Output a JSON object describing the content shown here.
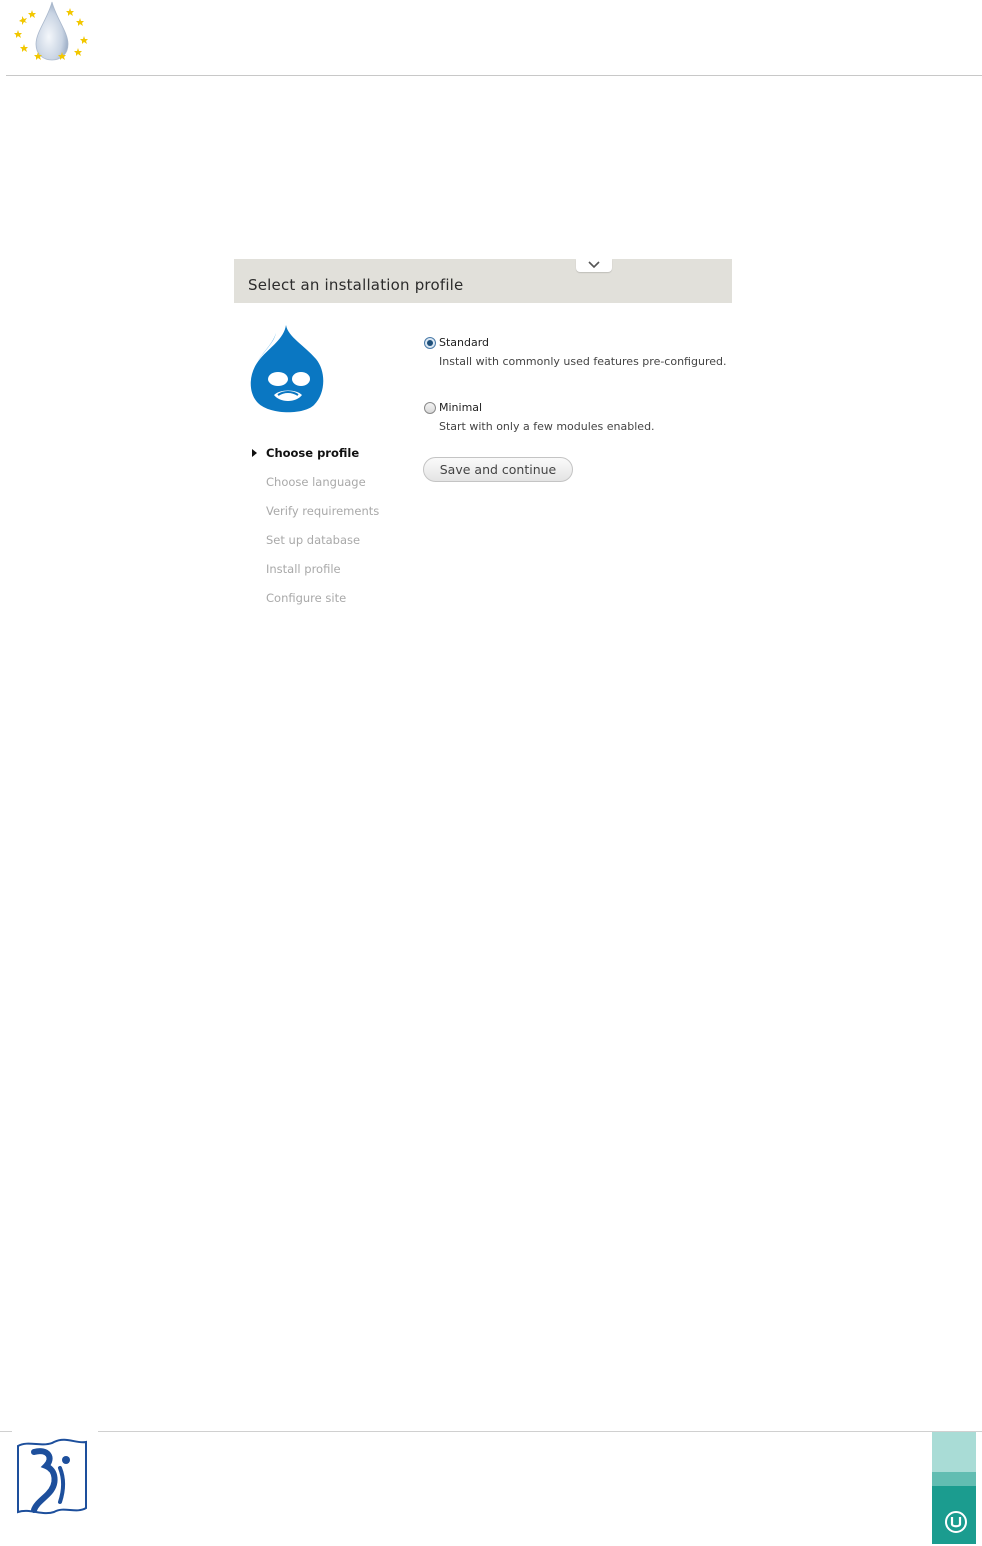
{
  "installer": {
    "title": "Select an installation profile",
    "steps": [
      {
        "label": "Choose profile",
        "active": true
      },
      {
        "label": "Choose language",
        "active": false
      },
      {
        "label": "Verify requirements",
        "active": false
      },
      {
        "label": "Set up database",
        "active": false
      },
      {
        "label": "Install profile",
        "active": false
      },
      {
        "label": "Configure site",
        "active": false
      }
    ],
    "profiles": [
      {
        "label": "Standard",
        "description": "Install with commonly used features pre-configured.",
        "selected": true
      },
      {
        "label": "Minimal",
        "description": "Start with only a few modules enabled.",
        "selected": false
      }
    ],
    "submit_label": "Save and continue"
  },
  "colors": {
    "header_bg": "#e1e0da",
    "drupal_blue": "#0a77c2",
    "footer_teal": "#1b9c8f"
  }
}
